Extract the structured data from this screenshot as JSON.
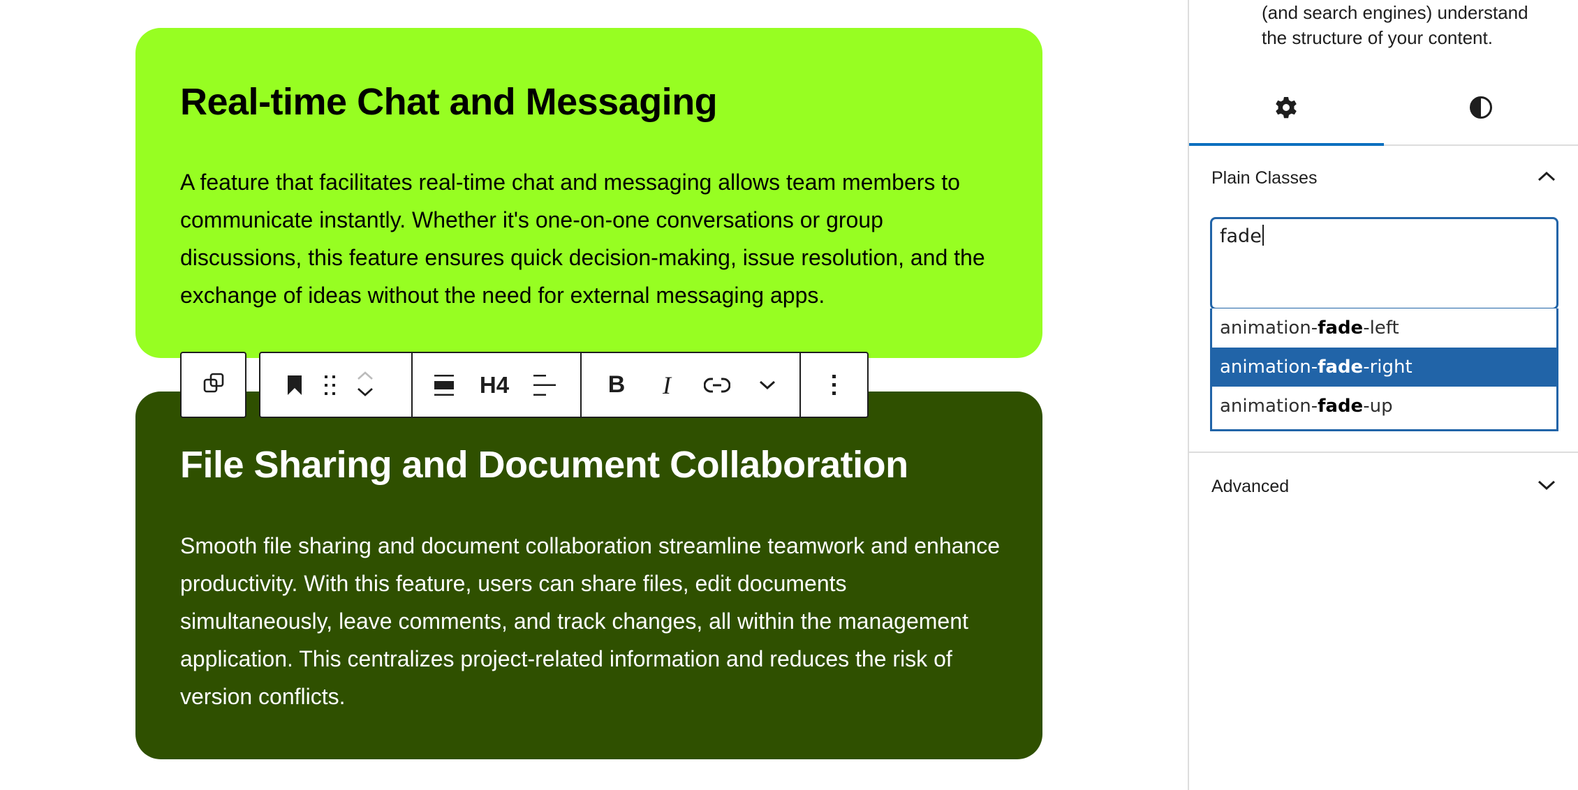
{
  "editor": {
    "blocks": [
      {
        "heading": "Real-time Chat and Messaging",
        "paragraph": "A feature that facilitates real-time chat and messaging allows team members to communicate instantly. Whether it's one-on-one conversations or group discussions, this feature ensures quick decision-making, issue resolution, and the exchange of ideas without the need for external messaging apps.",
        "background": "#97fe22",
        "text_color": "#000000"
      },
      {
        "heading": "File Sharing and Document Collaboration",
        "paragraph": "Smooth file sharing and document collaboration streamline teamwork and enhance productivity. With this feature, users can share files, edit documents simultaneously, leave comments, and track changes, all within the management application. This centralizes project-related information and reduces the risk of version conflicts.",
        "background": "#2f5000",
        "text_color": "#ffffff"
      }
    ]
  },
  "toolbar": {
    "parent_icon": "select-parent-icon",
    "block_icon": "bookmark-icon",
    "drag_icon": "drag-handle-icon",
    "move_up_icon": "chevron-up-icon",
    "move_down_icon": "chevron-down-icon",
    "align_icon": "align-none-icon",
    "heading_level": "H4",
    "text_align_icon": "align-left-icon",
    "bold_label": "B",
    "italic_label": "I",
    "link_icon": "link-icon",
    "more_rich_text_icon": "chevron-down-icon",
    "options_icon": "more-vertical-icon"
  },
  "sidebar": {
    "description": "(and search engines) understand the structure of your content.",
    "tabs": [
      {
        "name": "settings",
        "icon": "gear-icon",
        "active": true
      },
      {
        "name": "styles",
        "icon": "contrast-icon",
        "active": false
      }
    ],
    "plain_classes": {
      "title": "Plain Classes",
      "expanded": true,
      "input_value": "fade",
      "suggestions": [
        {
          "prefix": "animation-",
          "match": "fade",
          "suffix": "-left",
          "selected": false
        },
        {
          "prefix": "animation-",
          "match": "fade",
          "suffix": "-right",
          "selected": true
        },
        {
          "prefix": "animation-",
          "match": "fade",
          "suffix": "-up",
          "selected": false
        }
      ]
    },
    "advanced": {
      "title": "Advanced",
      "expanded": false
    },
    "accent_color": "#2164a8",
    "tab_indicator_color": "#0a6fbf"
  }
}
